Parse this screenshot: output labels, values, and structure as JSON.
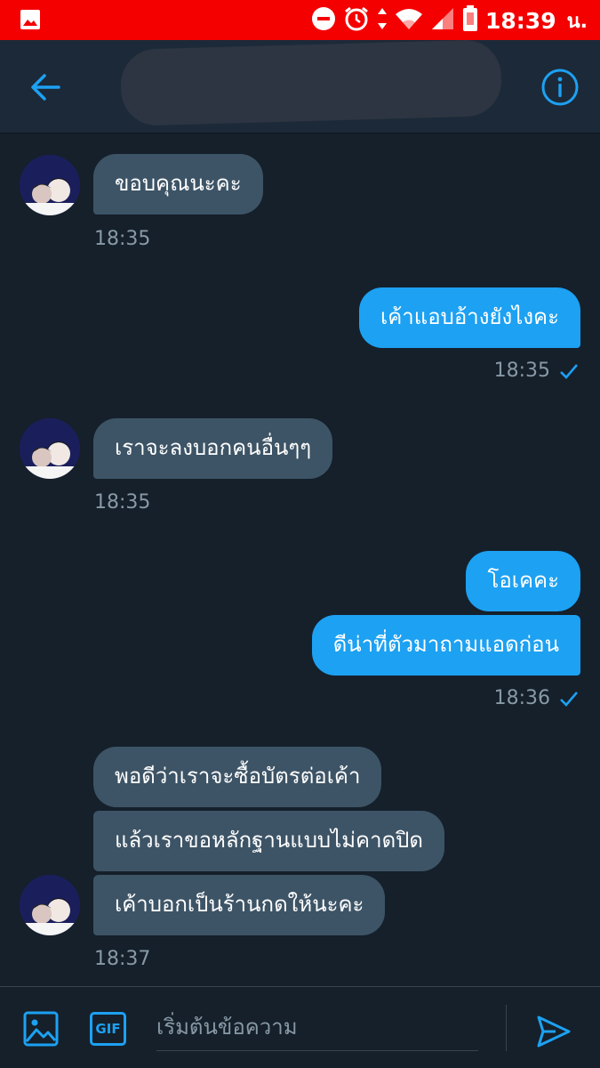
{
  "status_bar": {
    "time": "18:39",
    "time_suffix": "น.",
    "icons": [
      "image-icon",
      "do-not-disturb-icon",
      "alarm-icon",
      "data-arrows-icon",
      "wifi-icon",
      "signal-icon",
      "battery-icon"
    ]
  },
  "header": {
    "back_icon": "back-arrow-icon",
    "info_icon": "info-icon"
  },
  "messages": [
    {
      "side": "in",
      "text": "ขอบคุณนะคะ",
      "time": "18:35"
    },
    {
      "side": "out",
      "text": "เค้าแอบอ้างยังไงคะ",
      "time": "18:35"
    },
    {
      "side": "in",
      "text": "เราจะลงบอกคนอื่นๆๆ",
      "time": "18:35"
    },
    {
      "side": "out",
      "text": "โอเคคะ"
    },
    {
      "side": "out",
      "text": "ดีน่าที่ตัวมาถามแอดก่อน",
      "time": "18:36"
    },
    {
      "side": "in",
      "text": "พอดีว่าเราจะซื้อบัตรต่อเค้า"
    },
    {
      "side": "in",
      "text": "แล้วเราขอหลักฐานแบบไม่คาดปิด"
    },
    {
      "side": "in",
      "text": "เค้าบอกเป็นร้านกดให้นะคะ",
      "time": "18:37"
    }
  ],
  "composer": {
    "placeholder": "เริ่มต้นข้อความ",
    "gif_label": "GIF"
  },
  "colors": {
    "status_bar": "#f50000",
    "background": "#15202b",
    "header": "#1c2938",
    "incoming_bubble": "#3d5466",
    "outgoing_bubble": "#1da1f2",
    "accent": "#1da1f2",
    "timestamp": "#8899a6"
  }
}
